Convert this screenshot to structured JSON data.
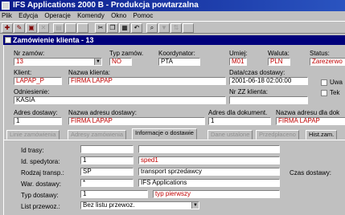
{
  "app": {
    "title": "IFS Applications 2000 B - Produkcja powtarzalna"
  },
  "menu": [
    "Plik",
    "Edycja",
    "Operacje",
    "Komendy",
    "Okno",
    "Pomoc"
  ],
  "toolbar": {
    "icons": [
      "new-icon",
      "edit-icon",
      "save-icon",
      "delete-icon",
      "doc-icon",
      "blank-icon",
      "blank-icon",
      "cut-icon",
      "copy-icon",
      "paste-icon",
      "undo-icon",
      "find-icon",
      "filter-icon",
      "sort-icon",
      "blank-icon"
    ]
  },
  "window": {
    "title": "Zamówienie klienta - 13"
  },
  "header": {
    "nr_zamow_label": "Nr zamów:",
    "nr_zamow": "13",
    "typ_zamow_label": "Typ zamów.",
    "typ_zamow": "NO",
    "koordynator_label": "Koordynator:",
    "koordynator": "PTA",
    "umiej_label": "Umiej:",
    "umiej": "M01",
    "waluta_label": "Waluta:",
    "waluta": "PLN",
    "status_label": "Status:",
    "status": "Zarezerwo",
    "klient_label": "Klient:",
    "klient": "LAPAP_P",
    "nazwa_klienta_label": "Nazwa klienta:",
    "nazwa_klienta": "FIRMA LAPAP",
    "data_label": "Data/czas dostawy:",
    "data": "2001-06-18 02:00:00",
    "uw_label": "Uwa",
    "tek_label": "Tek",
    "odniesienie_label": "Odniesienie:",
    "odniesienie": "KASIA",
    "nr_zz_label": "Nr ZZ klienta:",
    "adres_dost_label": "Adres dostawy:",
    "adres_dost": "1",
    "nazwa_adr_dost_label": "Nazwa adresu dostawy:",
    "nazwa_adr_dost": "FIRMA LAPAP",
    "adres_dok_label": "Adres dla dokument.",
    "adres_dok": "1",
    "nazwa_adr_dok_label": "Nazwa adresu dla dok",
    "nazwa_adr_dok": "FIRMA LAPAP"
  },
  "tabs": [
    "Linie zamówienia",
    "Adresy zamówienia",
    "Informacje o dostawie",
    "Dane ustalone",
    "Przedpłaceno",
    "Hist.zam."
  ],
  "delivery": {
    "id_trasy_label": "Id trasy:",
    "id_trasy": "",
    "id_trasy_desc": "",
    "id_spedytora_label": "Id. spedytora:",
    "id_spedytora": "1",
    "id_spedytora_desc": "sped1",
    "rodzaj_label": "Rodzaj transp.:",
    "rodzaj": "SP",
    "rodzaj_desc": "transport sprzedawcy",
    "czas_label": "Czas dostawy:",
    "war_label": "War. dostawy:",
    "war": "*",
    "war_desc": "IFS Applications",
    "typ_dostawy_label": "Typ dostawy:",
    "typ_dostawy": "1",
    "typ_dostawy_desc": "typ pierwszy",
    "list_label": "List przewoz.:",
    "list": "Bez listu przewoz."
  }
}
